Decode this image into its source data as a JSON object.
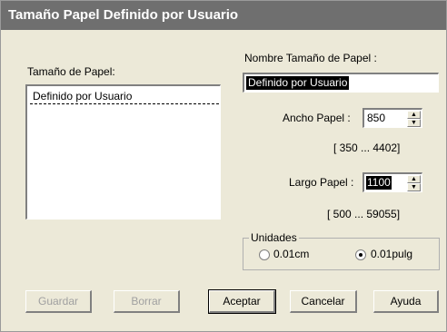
{
  "window": {
    "title": "Tamaño Papel Definido por Usuario"
  },
  "paper_size": {
    "label": "Tamaño de Papel:",
    "items": [
      {
        "label": "Definido por Usuario",
        "selected": true
      }
    ]
  },
  "paper_name": {
    "label": "Nombre Tamaño de Papel :",
    "value": "Definido por Usuario"
  },
  "width": {
    "label": "Ancho Papel :",
    "value": "850",
    "range": "[ 350 ...  4402]"
  },
  "height": {
    "label": "Largo Papel :",
    "value": "1100",
    "range": "[ 500 ... 59055]"
  },
  "units": {
    "label": "Unidades",
    "options": [
      {
        "label": "0.01cm",
        "checked": false
      },
      {
        "label": "0.01pulg",
        "checked": true
      }
    ]
  },
  "buttons": {
    "save": "Guardar",
    "delete": "Borrar",
    "accept": "Aceptar",
    "cancel": "Cancelar",
    "help": "Ayuda"
  },
  "icons": {
    "spin_up": "spin-up-arrow-icon",
    "spin_down": "spin-down-arrow-icon"
  },
  "colors": {
    "titlebar": "#6f6f6f",
    "dialog_bg": "#ece9d8",
    "selection": "#000000"
  }
}
